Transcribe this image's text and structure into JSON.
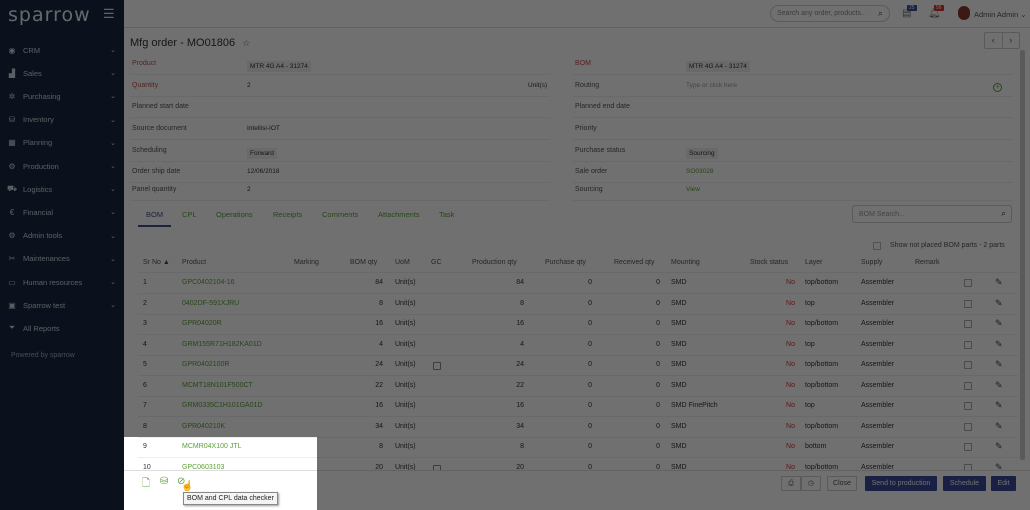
{
  "app": {
    "logo": "sparrow",
    "powered_by": "Powered by sparrow"
  },
  "sidebar": {
    "items": [
      {
        "label": "CRM",
        "icon": "crm-icon"
      },
      {
        "label": "Sales",
        "icon": "chart-icon"
      },
      {
        "label": "Purchasing",
        "icon": "purchasing-icon"
      },
      {
        "label": "Inventory",
        "icon": "inventory-icon"
      },
      {
        "label": "Planning",
        "icon": "calendar-icon"
      },
      {
        "label": "Production",
        "icon": "production-icon"
      },
      {
        "label": "Logistics",
        "icon": "truck-icon"
      },
      {
        "label": "Financial",
        "icon": "euro-icon"
      },
      {
        "label": "Admin tools",
        "icon": "gear-icon"
      },
      {
        "label": "Maintenances",
        "icon": "wrench-icon"
      },
      {
        "label": "Human resources",
        "icon": "id-card-icon"
      },
      {
        "label": "Sparrow test",
        "icon": "test-icon"
      },
      {
        "label": "All Reports",
        "icon": "filter-icon"
      }
    ]
  },
  "header": {
    "search_placeholder": "Search any order, products..",
    "tasks_badge": "25",
    "notifications_badge": "56",
    "user": "Admin Admin"
  },
  "page": {
    "title": "Mfg order - MO01806"
  },
  "form": {
    "left": [
      {
        "label": "Product",
        "value": "MTR 4G A4 - 31274",
        "required": true,
        "chip": true
      },
      {
        "label": "Quantity",
        "value": "2",
        "required": true,
        "unit": "Unit(s)"
      },
      {
        "label": "Planned start date",
        "value": ""
      },
      {
        "label": "Source document",
        "value": "Intellisi-IOT"
      },
      {
        "label": "Scheduling",
        "value": "Forward",
        "chip": true
      },
      {
        "label": "Order ship date",
        "value": "12/06/2018"
      },
      {
        "label": "Panel quantity",
        "value": "2"
      }
    ],
    "right": [
      {
        "label": "BOM",
        "value": "MTR 4G A4 - 31274",
        "required": true,
        "chip": true
      },
      {
        "label": "Routing",
        "value": "",
        "placeholder": "Type or click here"
      },
      {
        "label": "Planned end date",
        "value": ""
      },
      {
        "label": "Priority",
        "value": ""
      },
      {
        "label": "Purchase status",
        "value": "Sourcing",
        "chip": true
      },
      {
        "label": "Sale order",
        "value": "SO03028",
        "link": true
      },
      {
        "label": "Sourcing",
        "value": "View",
        "link": true
      }
    ]
  },
  "tabs": [
    "BOM",
    "CPL",
    "Operations",
    "Receipts",
    "Comments",
    "Attachments",
    "Task"
  ],
  "bom": {
    "search_placeholder": "BOM Search...",
    "show_not_placed": "Show not placed BOM parts - 2 parts",
    "columns": [
      "Sr No",
      "Product",
      "Marking",
      "BOM qty",
      "UoM",
      "GC",
      "Production qty",
      "Purchase qty",
      "Received qty",
      "Mounting",
      "Stock status",
      "Layer",
      "Supply",
      "Remark"
    ],
    "rows": [
      [
        "1",
        "GPC0402104-16",
        "",
        "84",
        "Unit(s)",
        "",
        "84",
        "0",
        "0",
        "SMD",
        "No",
        "top/bottom",
        "Assembler",
        ""
      ],
      [
        "2",
        "0402DF-591XJRU",
        "",
        "8",
        "Unit(s)",
        "",
        "8",
        "0",
        "0",
        "SMD",
        "No",
        "top",
        "Assembler",
        ""
      ],
      [
        "3",
        "GPR04020R",
        "",
        "16",
        "Unit(s)",
        "",
        "16",
        "0",
        "0",
        "SMD",
        "No",
        "top/bottom",
        "Assembler",
        ""
      ],
      [
        "4",
        "GRM155R71H182KA01D",
        "",
        "4",
        "Unit(s)",
        "",
        "4",
        "0",
        "0",
        "SMD",
        "No",
        "top",
        "Assembler",
        ""
      ],
      [
        "5",
        "GPR0402100R",
        "",
        "24",
        "Unit(s)",
        "gc",
        "24",
        "0",
        "0",
        "SMD",
        "No",
        "top/bottom",
        "Assembler",
        ""
      ],
      [
        "6",
        "MCMT18N101F500CT",
        "",
        "22",
        "Unit(s)",
        "",
        "22",
        "0",
        "0",
        "SMD",
        "No",
        "top/bottom",
        "Assembler",
        ""
      ],
      [
        "7",
        "GRM0335C1H101GA01D",
        "",
        "16",
        "Unit(s)",
        "",
        "16",
        "0",
        "0",
        "SMD FinePitch",
        "No",
        "top",
        "Assembler",
        ""
      ],
      [
        "8",
        "GPR040210K",
        "",
        "34",
        "Unit(s)",
        "",
        "34",
        "0",
        "0",
        "SMD",
        "No",
        "top/bottom",
        "Assembler",
        ""
      ],
      [
        "9",
        "MCMR04X100 JTL",
        "",
        "8",
        "Unit(s)",
        "",
        "8",
        "0",
        "0",
        "SMD",
        "No",
        "bottom",
        "Assembler",
        ""
      ],
      [
        "10",
        "GPC0603103",
        "",
        "20",
        "Unit(s)",
        "gc",
        "20",
        "0",
        "0",
        "SMD",
        "No",
        "top/bottom",
        "Assembler",
        ""
      ]
    ]
  },
  "footer": {
    "close": "Close",
    "send": "Send to production",
    "schedule": "Schedule",
    "edit": "Edit",
    "tooltip": "BOM and CPL data checker"
  },
  "colors": {
    "accent": "#3b4a9a",
    "link": "#5a9e3a",
    "required": "#c0504d",
    "sidebar": "#1b2840"
  }
}
